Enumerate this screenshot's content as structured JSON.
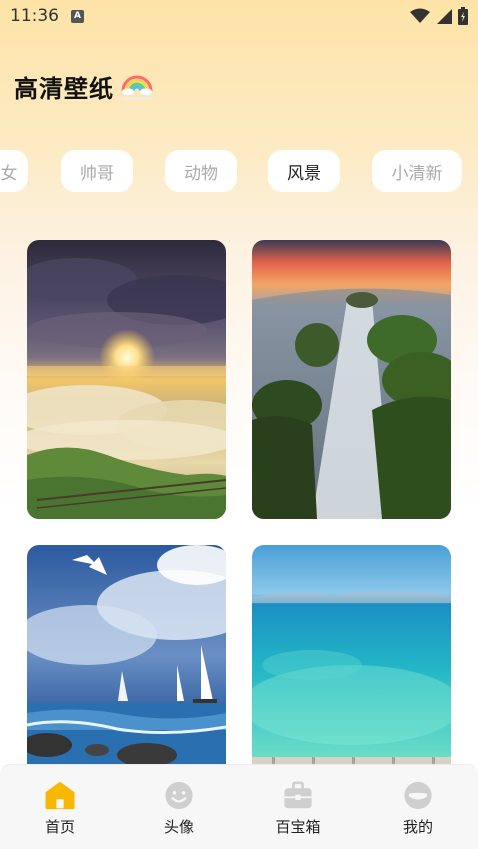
{
  "status_bar": {
    "time": "11:36",
    "notification_icon": "a-icon",
    "icons": [
      "wifi-icon",
      "signal-icon",
      "battery-icon"
    ]
  },
  "header": {
    "title": "高清壁纸",
    "icon": "rainbow-icon"
  },
  "tabs": [
    {
      "label": "女",
      "active": false
    },
    {
      "label": "帅哥",
      "active": false
    },
    {
      "label": "动物",
      "active": false
    },
    {
      "label": "风景",
      "active": true
    },
    {
      "label": "小清新",
      "active": false
    }
  ],
  "wallpapers": [
    {
      "name": "sunset-over-clouds",
      "kind": "photo"
    },
    {
      "name": "waterfall-mossy-rocks",
      "kind": "photo"
    },
    {
      "name": "sailboats-and-seagulls",
      "kind": "photo"
    },
    {
      "name": "turquoise-sea",
      "kind": "photo"
    }
  ],
  "bottom_nav": [
    {
      "label": "首页",
      "icon": "home-icon",
      "active": true
    },
    {
      "label": "头像",
      "icon": "avatar-smile-icon",
      "active": false
    },
    {
      "label": "百宝箱",
      "icon": "toolbox-icon",
      "active": false
    },
    {
      "label": "我的",
      "icon": "profile-icon",
      "active": false
    }
  ],
  "colors": {
    "accent": "#f9b800",
    "inactive_icon": "#cfcfcf",
    "header_gradient_top": "#fde3a6"
  }
}
